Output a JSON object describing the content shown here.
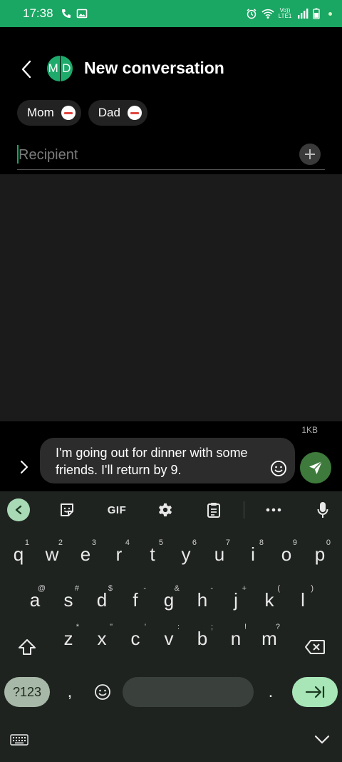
{
  "status_bar": {
    "time": "17:38",
    "volte_label": "Vo)) LTE1"
  },
  "header": {
    "avatar_initials": [
      "M",
      "D"
    ],
    "title": "New conversation"
  },
  "recipients": [
    {
      "name": "Mom"
    },
    {
      "name": "Dad"
    }
  ],
  "recipient_field": {
    "placeholder": "Recipient",
    "value": ""
  },
  "compose": {
    "size_label": "1KB",
    "message": "I'm going out for dinner with some friends. I'll return by 9."
  },
  "keyboard": {
    "toolbar": {
      "gif_label": "GIF"
    },
    "rows": [
      [
        {
          "key": "q",
          "hint": "1"
        },
        {
          "key": "w",
          "hint": "2"
        },
        {
          "key": "e",
          "hint": "3"
        },
        {
          "key": "r",
          "hint": "4"
        },
        {
          "key": "t",
          "hint": "5"
        },
        {
          "key": "y",
          "hint": "6"
        },
        {
          "key": "u",
          "hint": "7"
        },
        {
          "key": "i",
          "hint": "8"
        },
        {
          "key": "o",
          "hint": "9"
        },
        {
          "key": "p",
          "hint": "0"
        }
      ],
      [
        {
          "key": "a",
          "hint": "@"
        },
        {
          "key": "s",
          "hint": "#"
        },
        {
          "key": "d",
          "hint": "$"
        },
        {
          "key": "f",
          "hint": "-"
        },
        {
          "key": "g",
          "hint": "&"
        },
        {
          "key": "h",
          "hint": "-"
        },
        {
          "key": "j",
          "hint": "+"
        },
        {
          "key": "k",
          "hint": "("
        },
        {
          "key": "l",
          "hint": ")"
        }
      ],
      [
        {
          "key": "z",
          "hint": "*"
        },
        {
          "key": "x",
          "hint": "\""
        },
        {
          "key": "c",
          "hint": "'"
        },
        {
          "key": "v",
          "hint": ":"
        },
        {
          "key": "b",
          "hint": ";"
        },
        {
          "key": "n",
          "hint": "!"
        },
        {
          "key": "m",
          "hint": "?"
        }
      ]
    ],
    "symbols_label": "?123",
    "comma_label": ",",
    "period_label": "."
  },
  "colors": {
    "status_bar": "#1aa663",
    "avatar": "#1eaa6a",
    "send_button": "#3e7a3c",
    "enter_key": "#a8e6b8",
    "remove_chip": "#e0463e"
  }
}
